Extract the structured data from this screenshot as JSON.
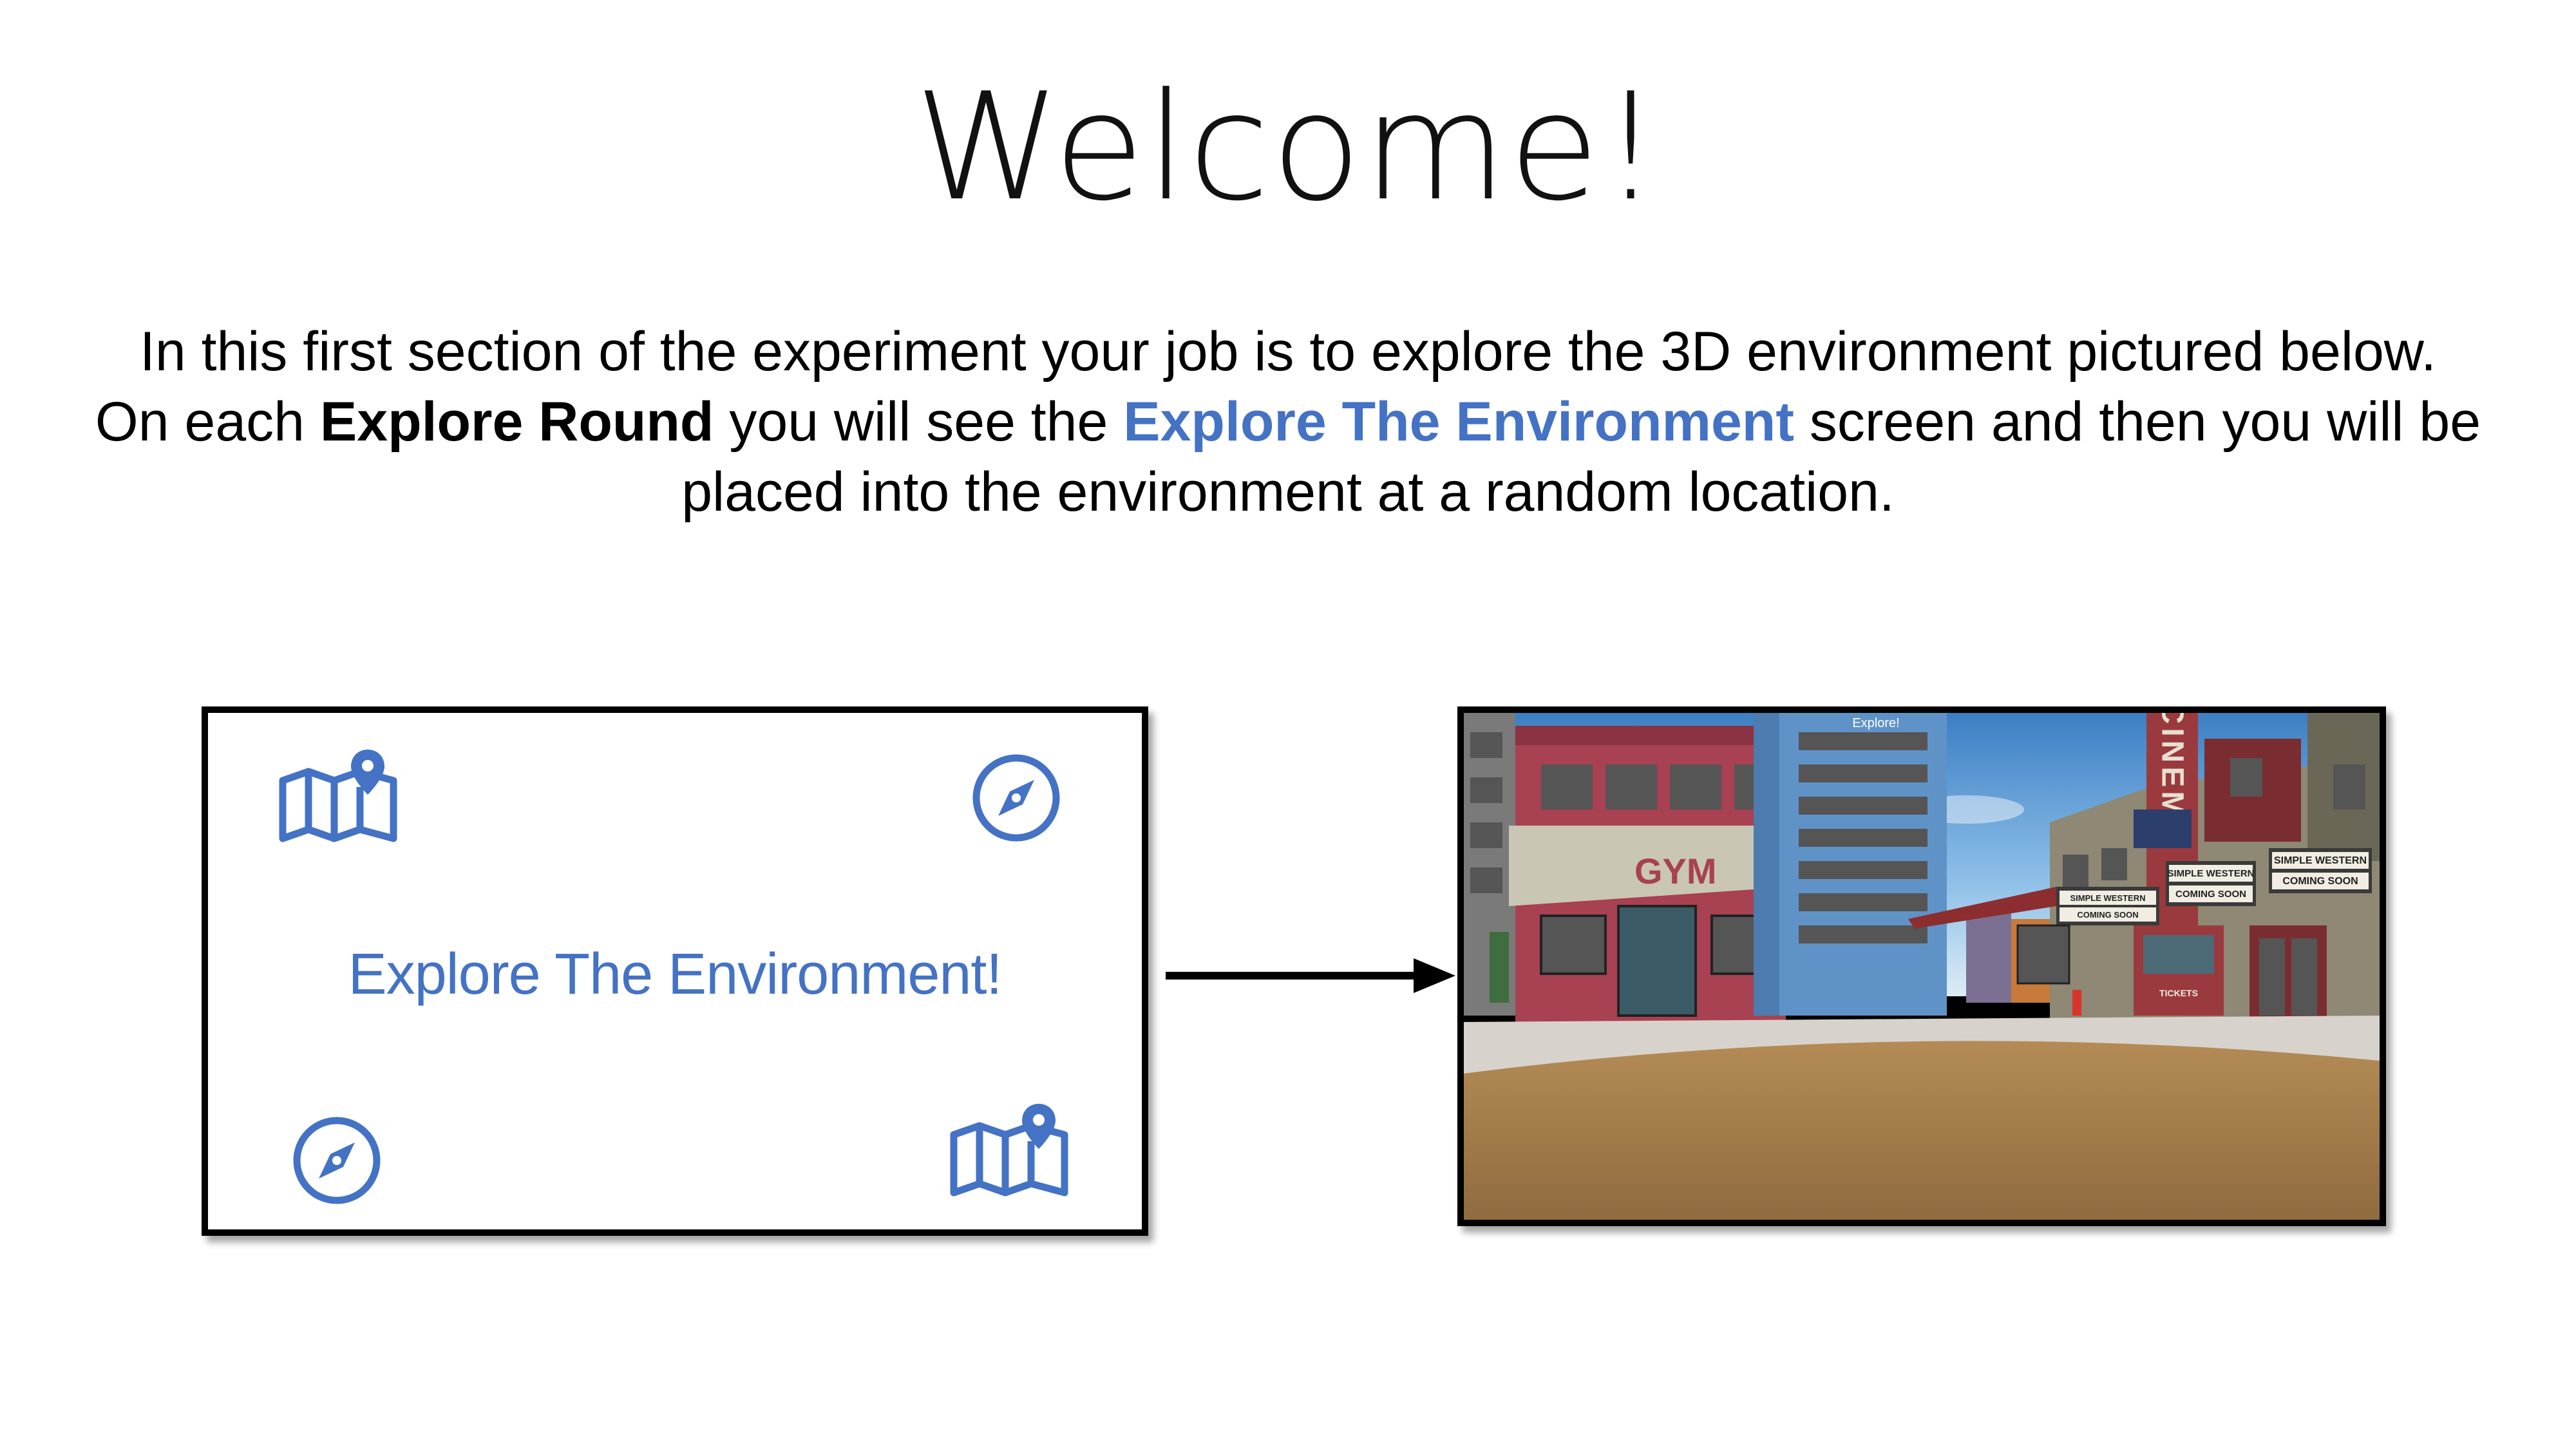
{
  "title": "Welcome!",
  "intro": {
    "line1": "In this first section of the experiment your job is to explore the 3D environment pictured below.",
    "line2_a": "On each ",
    "line2_bold": "Explore Round",
    "line2_b": " you will see the ",
    "line2_highlight": "Explore The Environment",
    "line2_c": " screen and then you will be",
    "line3": "placed into the environment at a random location."
  },
  "explore_card": {
    "label": "Explore The Environment!",
    "icons": [
      "map-pin-icon",
      "compass-icon",
      "compass-icon",
      "map-pin-icon"
    ]
  },
  "scene": {
    "hud_text": "Explore!",
    "gym_sign": "GYM",
    "cinema_sign": "CINEM",
    "marquee_1": "SIMPLE WESTERN",
    "marquee_2": "COMING SOON",
    "marquee_3": "SIMPLE WESTERN",
    "marquee_4": "COMING SOON",
    "marquee_5": "SIMPLE WESTERN",
    "marquee_6": "COMING SOON",
    "ticket_sign": "TICKETS"
  },
  "colors": {
    "accent": "#4472C4",
    "text": "#000000"
  }
}
